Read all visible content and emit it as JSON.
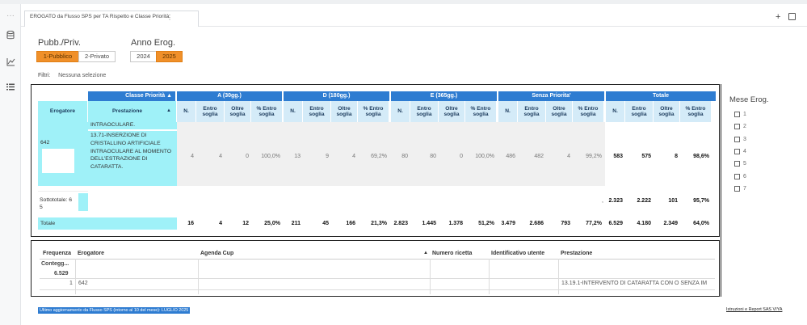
{
  "tab": {
    "title": "EROGATO da Flusso SPS per TA Rispetto e Classe Priorità",
    "menu_icon": "more-vertical-icon"
  },
  "toolbar": {
    "add_label": "+",
    "copy_icon": "copy-icon"
  },
  "rail": {
    "icons": [
      "collapse-icon",
      "data-icon",
      "objects-icon",
      "outline-icon"
    ]
  },
  "controls": {
    "pubb_priv": {
      "title": "Pubb./Priv.",
      "options": [
        "1-Pubblico",
        "2-Privato"
      ],
      "selected": "1-Pubblico"
    },
    "anno": {
      "title": "Anno Erog.",
      "options": [
        "2024",
        "2025"
      ],
      "selected": "2025"
    }
  },
  "filters": {
    "label": "Filtri:",
    "value": "Nessuna selezione"
  },
  "crosstab": {
    "classe_header": "Classe Priorità ▲",
    "row_headers": {
      "erogatore": "Erogatore",
      "erogatore_sort": "▲",
      "prestazione": "Prestazione",
      "prestazione_sort": "▲"
    },
    "groups": [
      "A (30gg.)",
      "D (180gg.)",
      "E (365gg.)",
      "Senza Priorita'",
      "Totale"
    ],
    "subcols": [
      "N.",
      "Entro soglia",
      "Oltre soglia",
      "% Entro soglia"
    ],
    "erogatore_value": "642",
    "prestazione_prev_tail": "INTRAOCULARE.",
    "prestazione_value": "13.71-INSERZIONE DI CRISTALLINO ARTIFICIALE INTRAOCULARE AL MOMENTO DELL'ESTRAZIONE DI CATARATTA.",
    "row_values": [
      [
        "4",
        "4",
        "0",
        "100,0%"
      ],
      [
        "13",
        "9",
        "4",
        "69,2%"
      ],
      [
        "80",
        "80",
        "0",
        "100,0%"
      ],
      [
        "486",
        "482",
        "4",
        "99,2%"
      ],
      [
        "583",
        "575",
        "8",
        "98,6%"
      ]
    ],
    "subtotal_label": "Sottototale: 6",
    "subtotal_label2": "5",
    "subtotal_dot": ",",
    "subtotal_values": [
      "2.323",
      "2.222",
      "101",
      "95,7%"
    ],
    "total_label": "Totale",
    "total_values": [
      [
        "16",
        "4",
        "12",
        "25,0%"
      ],
      [
        "211",
        "45",
        "166",
        "21,3%"
      ],
      [
        "2.823",
        "1.445",
        "1.378",
        "51,2%"
      ],
      [
        "3.479",
        "2.686",
        "793",
        "77,2%"
      ],
      [
        "6.529",
        "4.180",
        "2.349",
        "64,0%"
      ]
    ]
  },
  "detail": {
    "headers": [
      "Frequenza",
      "Erogatore",
      "Agenda Cup",
      "Numero ricetta",
      "Identificativo utente",
      "Prestazione"
    ],
    "sort_marker": "▲",
    "row0": {
      "frequenza": "Contegg...",
      "frequenza_total": "6.529"
    },
    "row1": {
      "frequenza": "1",
      "erogatore": "642",
      "prestazione": "13.19.1-INTERVENTO DI CATARATTA CON O SENZA IM"
    }
  },
  "mese": {
    "title": "Mese Erog.",
    "options": [
      "1",
      "2",
      "3",
      "4",
      "5",
      "6",
      "7"
    ]
  },
  "footer": {
    "left": "Ultimo aggiornamento da Flusso SPS (intorno al 10 del mese): LUGLIO 2025",
    "right": "Istruzioni e Report SAS VIYA"
  },
  "colors": {
    "accent": "#f0902a",
    "header_blue": "#2e7cd1",
    "row_cyan": "#9ff1f8",
    "subheader": "#d4ebf8"
  }
}
